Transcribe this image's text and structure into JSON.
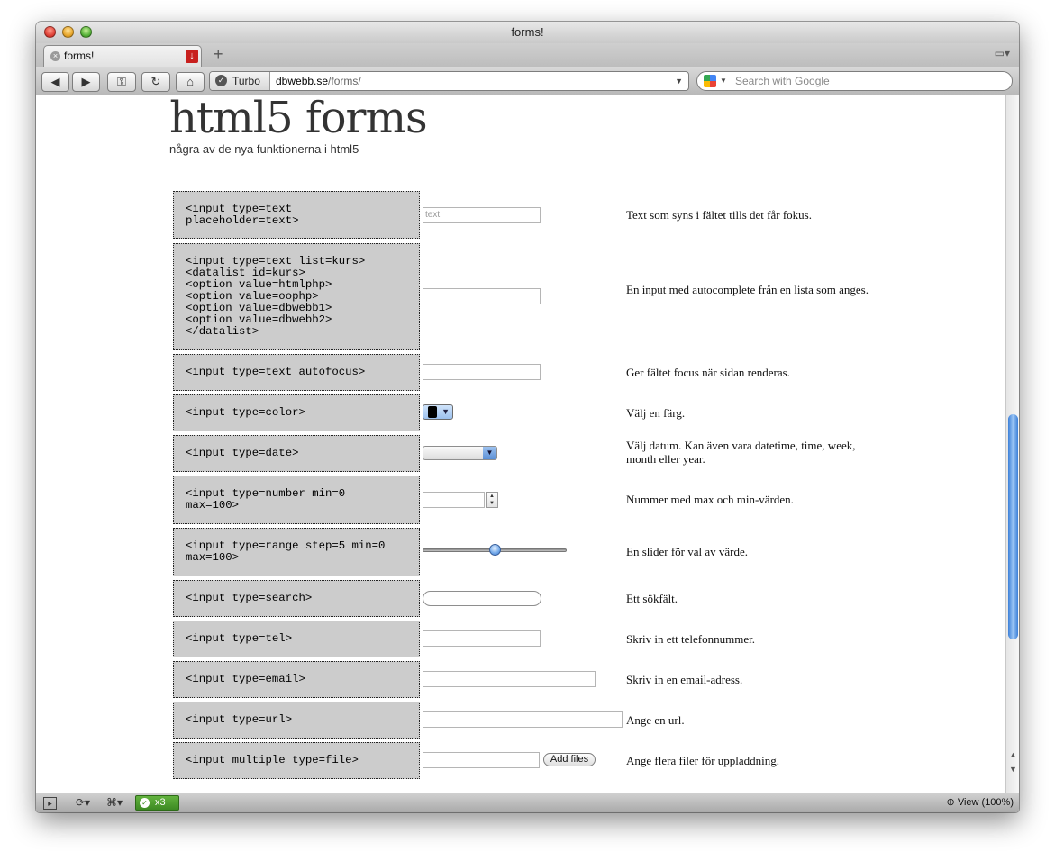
{
  "window": {
    "title": "forms!",
    "tab_title": "forms!",
    "tab_close": "×",
    "tab_add": "+",
    "tab_menu": "▭▾"
  },
  "toolbar": {
    "back": "◀",
    "forward": "▶",
    "key": "⚿",
    "reload": "↻",
    "home": "⌂",
    "turbo_icon": "✓",
    "turbo_label": "Turbo",
    "url_host": "dbwebb.se",
    "url_path": "/forms/",
    "addr_dropdown": "▼",
    "search_dropdown": "▼",
    "search_placeholder": "Search with Google"
  },
  "page": {
    "title": "html5 forms",
    "subtitle": "några av de nya funktionerna i html5",
    "rows": [
      {
        "code": "<input type=text\nplaceholder=text>",
        "placeholder": "text",
        "desc": "Text som syns i fältet tills det får fokus."
      },
      {
        "code": "<input type=text list=kurs>\n<datalist id=kurs>\n<option value=htmlphp>\n<option value=oophp>\n<option value=dbwebb1>\n<option value=dbwebb2>\n</datalist>",
        "desc": "En input med autocomplete från en lista som anges."
      },
      {
        "code": "<input type=text autofocus>",
        "desc": "Ger fältet focus när sidan renderas."
      },
      {
        "code": "<input type=color>",
        "desc": "Välj en färg.",
        "color_value": "#000000",
        "dropdown": "▼"
      },
      {
        "code": "<input type=date>",
        "desc": "Välj datum. Kan även vara datetime, time, week, month eller year.",
        "dropdown": "▼"
      },
      {
        "code": "<input type=number min=0\nmax=100>",
        "desc": "Nummer med max och min-värden.",
        "step_up": "▲",
        "step_down": "▼"
      },
      {
        "code": "<input type=range step=5 min=0\nmax=100>",
        "desc": "En slider för val av värde.",
        "range_value": 50
      },
      {
        "code": "<input type=search>",
        "desc": "Ett sökfält."
      },
      {
        "code": "<input type=tel>",
        "desc": "Skriv in ett telefonnummer."
      },
      {
        "code": "<input type=email>",
        "desc": "Skriv in en email-adress."
      },
      {
        "code": "<input type=url>",
        "desc": "Ange en url."
      },
      {
        "code": "<input multiple type=file>",
        "desc": "Ange flera filer för uppladdning.",
        "button": "Add files"
      }
    ]
  },
  "scrollbar": {
    "up": "▲",
    "down": "▼"
  },
  "statusbar": {
    "panel_toggle": "▸",
    "sync": "⟳▾",
    "share": "⌘▾",
    "unite_icon": "✓",
    "unite_label": "x3",
    "zoom_label": "View (100%)"
  }
}
